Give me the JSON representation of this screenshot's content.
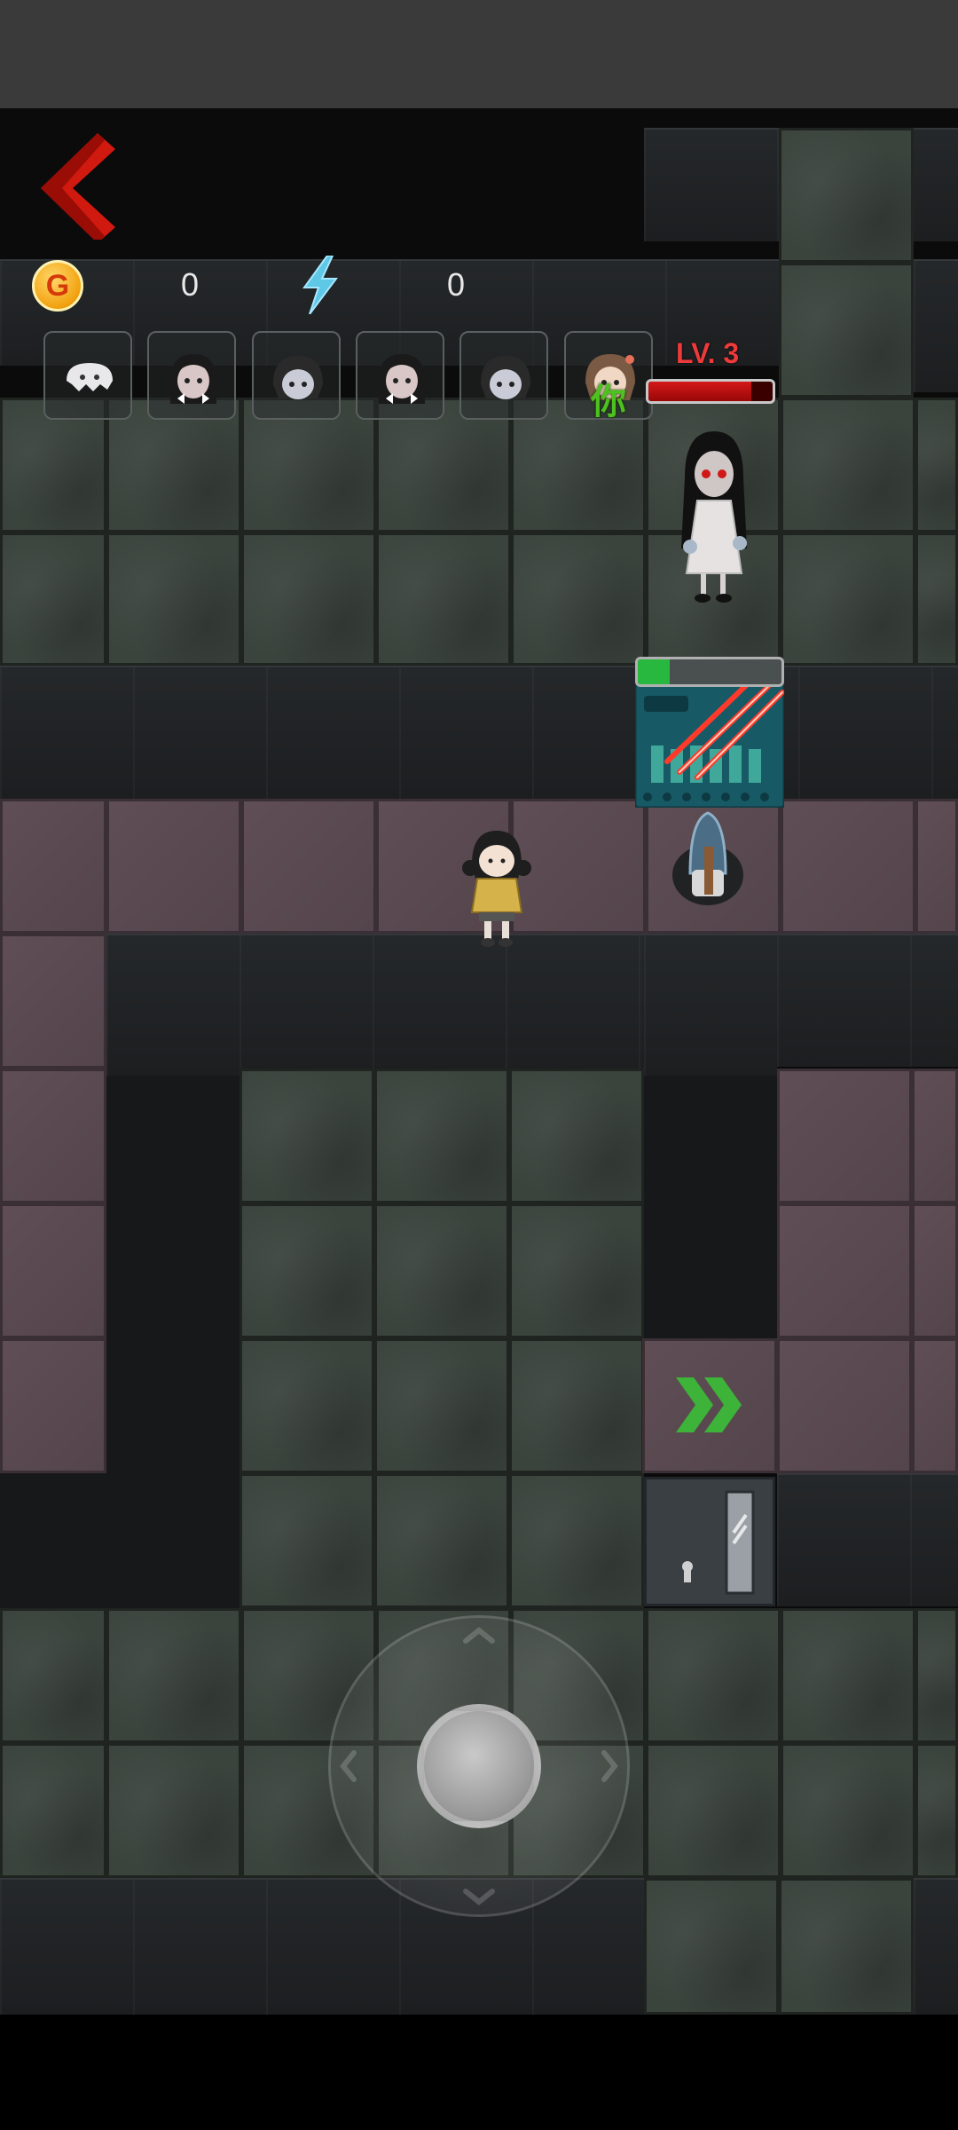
{
  "hud": {
    "coin_symbol": "G",
    "coin_count": "0",
    "energy_icon": "lightning-bolt-icon",
    "energy_count": "0"
  },
  "characters": [
    {
      "name": "ghost-blob",
      "selected": false
    },
    {
      "name": "girl-black-hair-bows",
      "selected": false
    },
    {
      "name": "girl-short-hair-pale",
      "selected": false
    },
    {
      "name": "girl-black-hair-bows",
      "selected": false
    },
    {
      "name": "girl-short-hair-pale",
      "selected": false
    },
    {
      "name": "girl-brown-hair-you",
      "selected": true
    }
  ],
  "you_label": "你",
  "enemy": {
    "level_label": "LV. 3",
    "health_fraction": 0.83
  },
  "machine": {
    "progress_fraction": 0.22
  },
  "colors": {
    "back_arrow": "#d11a0f",
    "level_text": "#ee3a3a",
    "you_text": "#4dc21e",
    "progress_fill": "#28b840",
    "health_fill": "#d41818",
    "arrow_green": "#3db33a"
  }
}
